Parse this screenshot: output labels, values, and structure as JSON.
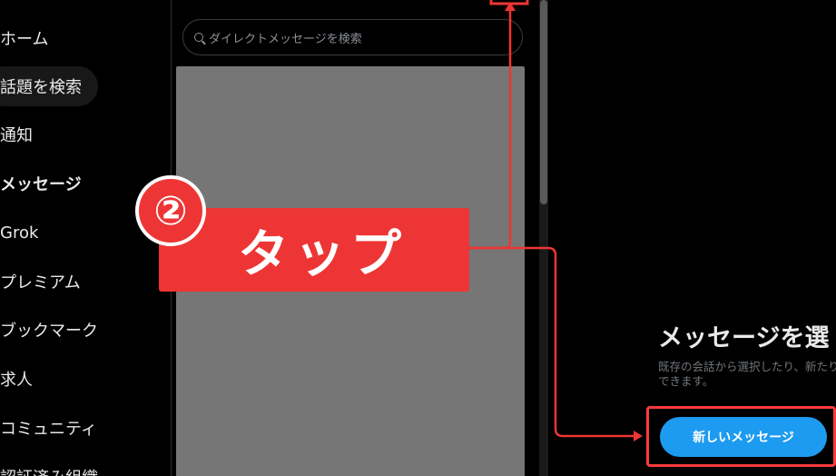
{
  "sidebar": {
    "items": [
      {
        "label": "ホーム"
      },
      {
        "label": "話題を検索"
      },
      {
        "label": "通知"
      },
      {
        "label": "メッセージ"
      },
      {
        "label": "Grok"
      },
      {
        "label": "プレミアム"
      },
      {
        "label": "ブックマーク"
      },
      {
        "label": "求人"
      },
      {
        "label": "コミュニティ"
      },
      {
        "label": "認証済み組織"
      }
    ]
  },
  "messages": {
    "search_placeholder": "ダイレクトメッセージを検索"
  },
  "detail": {
    "title": "メッセージを選",
    "subtitle": "既存の会話から選択したり、新たりできます。",
    "new_message_label": "新しいメッセージ"
  },
  "annotation": {
    "step": "②",
    "text": "タップ",
    "color": "#ee3535"
  },
  "colors": {
    "accent": "#1d9bf0",
    "annotation_red": "#ee3535"
  }
}
